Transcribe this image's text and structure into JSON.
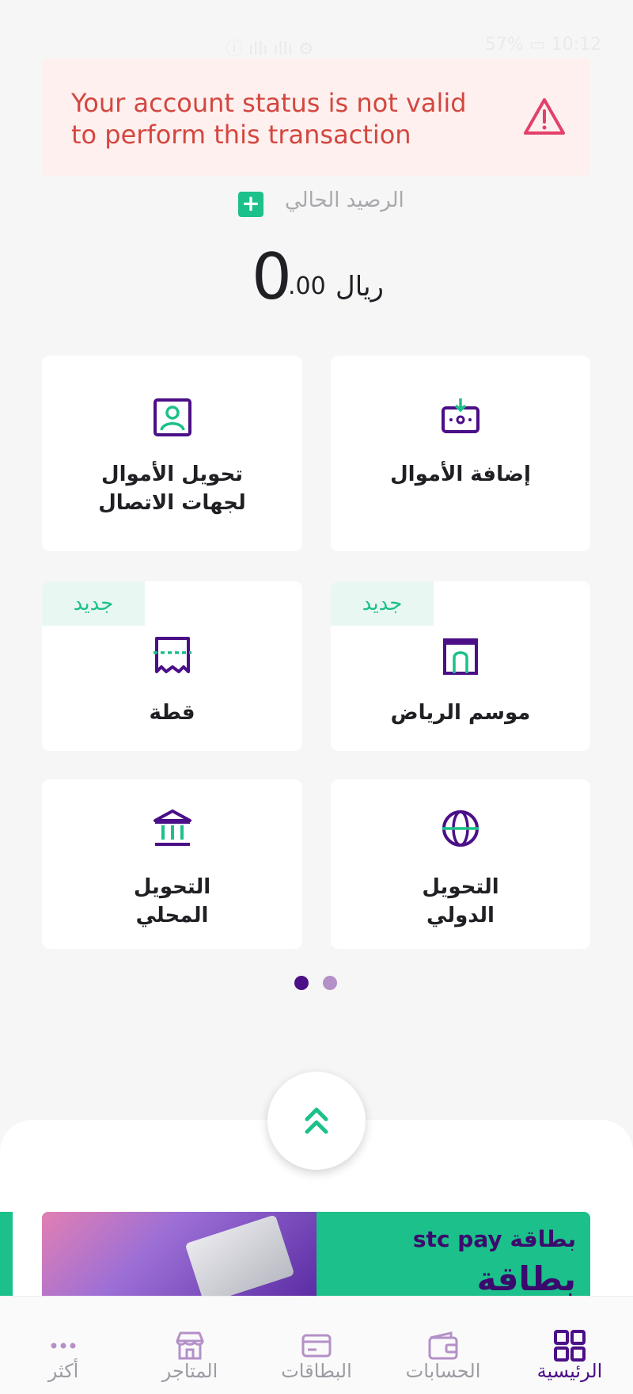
{
  "status_bar": {
    "left": "ⓘ ıllı ıllı ⚙",
    "right": "57% ▭ 10:12"
  },
  "alert": {
    "message": "Your account status is not valid to perform this transaction",
    "icon": "warning-icon"
  },
  "balance": {
    "label": "الرصيد الحالي",
    "integer": "0",
    "decimal": ".00",
    "currency": "ريال",
    "add_icon": "plus-icon"
  },
  "tiles": [
    {
      "label": "إضافة الأموال",
      "icon": "add-money-icon",
      "badge": ""
    },
    {
      "label": "تحويل الأموال\nلجهات الاتصال",
      "icon": "contact-transfer-icon",
      "badge": ""
    },
    {
      "label": "موسم الرياض",
      "icon": "riyadh-season-icon",
      "badge": "جديد"
    },
    {
      "label": "قطة",
      "icon": "split-bill-icon",
      "badge": "جديد"
    },
    {
      "label": "التحويل\nالدولي",
      "icon": "globe-icon",
      "badge": ""
    },
    {
      "label": "التحويل\nالمحلي",
      "icon": "bank-icon",
      "badge": ""
    }
  ],
  "pagination": {
    "pages": 2,
    "active": 1
  },
  "banner": {
    "title": "بطاقة stc pay",
    "subtitle": "بطاقة"
  },
  "tabbar": [
    {
      "label": "الرئيسية",
      "icon": "grid-icon",
      "active": true
    },
    {
      "label": "الحسابات",
      "icon": "wallet-icon",
      "active": false
    },
    {
      "label": "البطاقات",
      "icon": "card-icon",
      "active": false
    },
    {
      "label": "المتاجر",
      "icon": "store-icon",
      "active": false
    },
    {
      "label": "أكثر",
      "icon": "more-icon",
      "active": false
    }
  ],
  "colors": {
    "purple": "#4b0f87",
    "green": "#1cc08a",
    "alert_red": "#d3473f",
    "inactive": "#b490c8"
  }
}
